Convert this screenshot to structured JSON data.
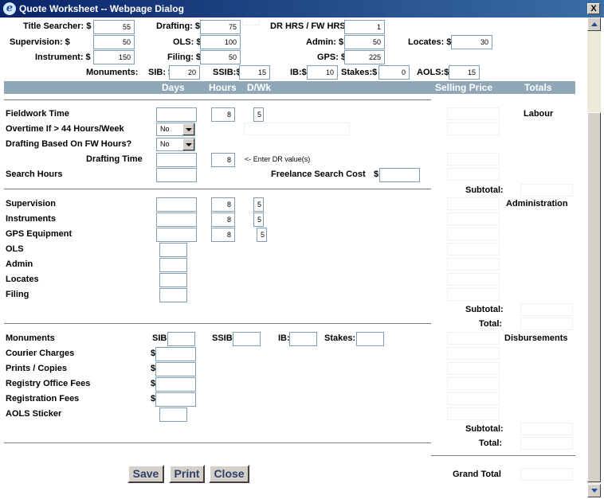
{
  "window": {
    "title": "Quote Worksheet -- Webpage Dialog",
    "close_glyph": "X",
    "icon_letter": "e"
  },
  "rates": {
    "title_searcher": {
      "label": "Title Searcher: $",
      "value": "55"
    },
    "drafting": {
      "label": "Drafting: $",
      "value": "75"
    },
    "dr_fw_hrs": {
      "label": "DR HRS / FW HRS:",
      "value": "1"
    },
    "supervision": {
      "label": "Supervision: $",
      "value": "50"
    },
    "ols": {
      "label": "OLS: $",
      "value": "100"
    },
    "admin": {
      "label": "Admin: $",
      "value": "50"
    },
    "locates": {
      "label": "Locates: $",
      "value": "30"
    },
    "instrument": {
      "label": "Instrument: $",
      "value": "150"
    },
    "filing": {
      "label": "Filing: $",
      "value": "50"
    },
    "gps": {
      "label": "GPS: $",
      "value": "225"
    },
    "monuments_label": "Monuments:",
    "sib": {
      "label": "SIB: $",
      "value": "20"
    },
    "ssib": {
      "label": "SSIB:$",
      "value": "15"
    },
    "ib": {
      "label": "IB:$",
      "value": "10"
    },
    "stakes": {
      "label": "Stakes:$",
      "value": "0"
    },
    "aols": {
      "label": "AOLS:$",
      "value": "15"
    }
  },
  "headers": {
    "days": "Days",
    "hours": "Hours",
    "dwk": "D/Wk",
    "selling_price": "Selling Price",
    "totals": "Totals"
  },
  "labour": {
    "section_label": "Labour",
    "fieldwork_time": {
      "label": "Fieldwork Time",
      "hours": "8",
      "dwk": "5"
    },
    "overtime": {
      "label": "Overtime If > 44 Hours/Week",
      "value": "No"
    },
    "drafting_based": {
      "label": "Drafting Based On FW Hours?",
      "value": "No"
    },
    "drafting_time": {
      "label": "Drafting Time",
      "hours": "8",
      "hint": "<- Enter DR value(s)"
    },
    "search_hours": {
      "label": "Search Hours"
    },
    "freelance_search": {
      "label": "Freelance Search Cost",
      "currency": "$"
    },
    "subtotal_label": "Subtotal:"
  },
  "administration": {
    "section_label": "Administration",
    "supervision": {
      "label": "Supervision",
      "hours": "8",
      "dwk": "5"
    },
    "instruments": {
      "label": "Instruments",
      "hours": "8",
      "dwk": "5"
    },
    "gps_equipment": {
      "label": "GPS Equipment",
      "hours": "8",
      "dwk": "5"
    },
    "ols": {
      "label": "OLS"
    },
    "admin": {
      "label": "Admin"
    },
    "locates": {
      "label": "Locates"
    },
    "filing": {
      "label": "Filing"
    },
    "subtotal_label": "Subtotal:",
    "total_label": "Total:"
  },
  "disbursements": {
    "section_label": "Disbursements",
    "monuments": {
      "label": "Monuments",
      "sib": "SIB:",
      "ssib": "SSIB:",
      "ib": "IB:",
      "stakes": "Stakes:"
    },
    "courier": {
      "label": "Courier Charges",
      "currency": "$"
    },
    "prints": {
      "label": "Prints / Copies",
      "currency": "$"
    },
    "registry": {
      "label": "Registry Office Fees",
      "currency": "$"
    },
    "registration": {
      "label": "Registration Fees",
      "currency": "$"
    },
    "aols_sticker": {
      "label": "AOLS Sticker"
    },
    "subtotal_label": "Subtotal:",
    "total_label": "Total:"
  },
  "grand_total_label": "Grand Total",
  "buttons": {
    "save": "Save",
    "print": "Print",
    "close": "Close"
  },
  "colors": {
    "header_bar": "#8fa7b6",
    "titlebar_start": "#0a246a",
    "titlebar_end": "#3a6ea5"
  }
}
